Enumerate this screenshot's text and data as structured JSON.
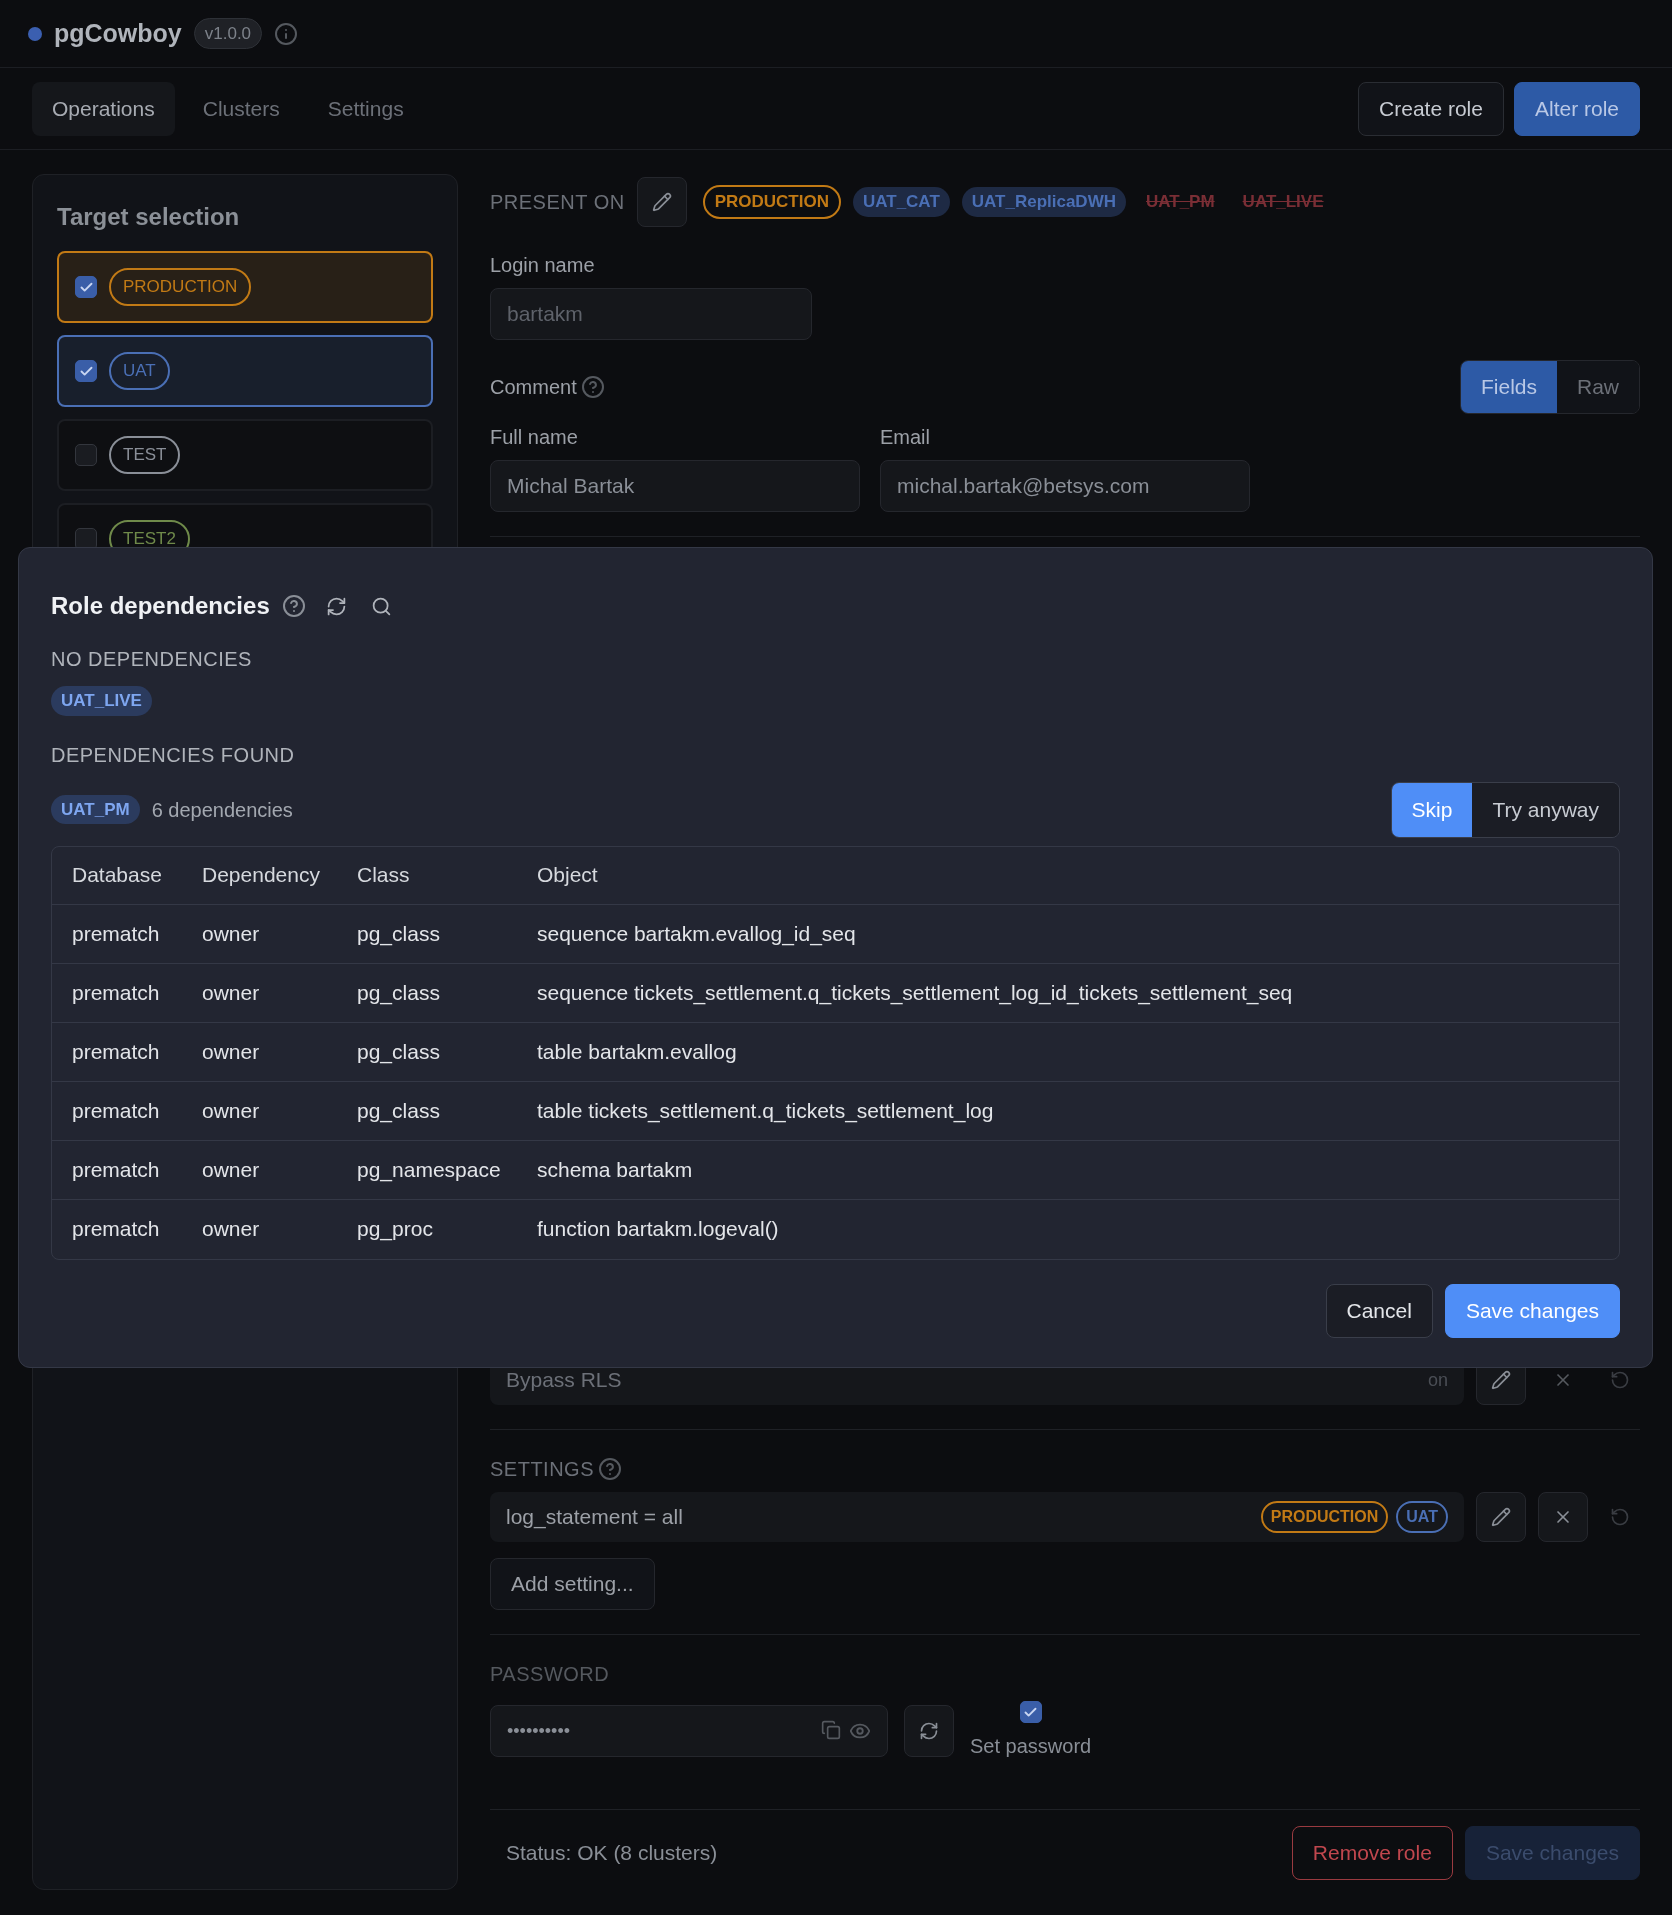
{
  "app": {
    "name": "pgCowboy",
    "version": "v1.0.0"
  },
  "nav": {
    "tabs": [
      {
        "label": "Operations",
        "selected": true
      },
      {
        "label": "Clusters",
        "selected": false
      },
      {
        "label": "Settings",
        "selected": false
      }
    ],
    "actions": [
      {
        "label": "Create role",
        "kind": "secondary"
      },
      {
        "label": "Alter role",
        "kind": "primary"
      }
    ]
  },
  "target_selection": {
    "title": "Target selection",
    "clusters": [
      {
        "label": "PRODUCTION",
        "checked": true,
        "color": "#c27a15"
      },
      {
        "label": "UAT",
        "checked": true,
        "color": "#4a6fb5"
      },
      {
        "label": "TEST",
        "checked": false,
        "color": "#8a8f98"
      },
      {
        "label": "TEST2",
        "checked": false,
        "color": "#6f8a4a"
      }
    ]
  },
  "role_form": {
    "present_on": {
      "label": "PRESENT ON",
      "tags": [
        {
          "label": "PRODUCTION",
          "kind": "outline",
          "color": "#c27a15"
        },
        {
          "label": "UAT_CAT",
          "kind": "filled",
          "color": "#1e2a44"
        },
        {
          "label": "UAT_ReplicaDWH",
          "kind": "filled",
          "color": "#1e2a44"
        },
        {
          "label": "UAT_PM",
          "kind": "removed",
          "color": "#7a2e35"
        },
        {
          "label": "UAT_LIVE",
          "kind": "removed",
          "color": "#7a2e35"
        }
      ]
    },
    "login_name": {
      "label": "Login name",
      "value": "bartakm"
    },
    "comment": {
      "label": "Comment",
      "modes": [
        {
          "label": "Fields",
          "selected": true
        },
        {
          "label": "Raw",
          "selected": false
        }
      ],
      "full_name": {
        "label": "Full name",
        "value": "Michal Bartak"
      },
      "email": {
        "label": "Email",
        "value": "michal.bartak@betsys.com"
      }
    },
    "bypass": {
      "label": "Bypass RLS",
      "value": "on"
    },
    "settings": {
      "title": "SETTINGS",
      "items": [
        {
          "text": "log_statement = all",
          "tags": [
            {
              "label": "PRODUCTION",
              "color": "#c27a15"
            },
            {
              "label": "UAT",
              "color": "#4a6fb5"
            }
          ]
        }
      ],
      "add_button": "Add setting..."
    },
    "password": {
      "title": "PASSWORD",
      "value": "••••••••••",
      "set_password": {
        "label": "Set password",
        "checked": true
      }
    },
    "status": "Status: OK (8 clusters)",
    "buttons": [
      {
        "label": "Remove role",
        "kind": "danger"
      },
      {
        "label": "Save changes",
        "kind": "disabled"
      }
    ]
  },
  "modal": {
    "title": "Role dependencies",
    "no_dependencies": {
      "title": "NO DEPENDENCIES",
      "tags": [
        "UAT_LIVE"
      ]
    },
    "dependencies_found": {
      "title": "DEPENDENCIES FOUND",
      "groups": [
        {
          "tag": "UAT_PM",
          "count": "6 dependencies"
        }
      ]
    },
    "modes": [
      {
        "label": "Skip",
        "selected": true
      },
      {
        "label": "Try anyway",
        "selected": false
      }
    ],
    "table": {
      "columns": [
        "Database",
        "Dependency",
        "Class",
        "Object"
      ],
      "rows": [
        [
          "prematch",
          "owner",
          "pg_class",
          "sequence bartakm.evallog_id_seq"
        ],
        [
          "prematch",
          "owner",
          "pg_class",
          "sequence tickets_settlement.q_tickets_settlement_log_id_tickets_settlement_seq"
        ],
        [
          "prematch",
          "owner",
          "pg_class",
          "table bartakm.evallog"
        ],
        [
          "prematch",
          "owner",
          "pg_class",
          "table tickets_settlement.q_tickets_settlement_log"
        ],
        [
          "prematch",
          "owner",
          "pg_namespace",
          "schema bartakm"
        ],
        [
          "prematch",
          "owner",
          "pg_proc",
          "function bartakm.logeval()"
        ]
      ]
    },
    "buttons": [
      {
        "label": "Cancel",
        "kind": "secondary"
      },
      {
        "label": "Save changes",
        "kind": "primary"
      }
    ]
  }
}
